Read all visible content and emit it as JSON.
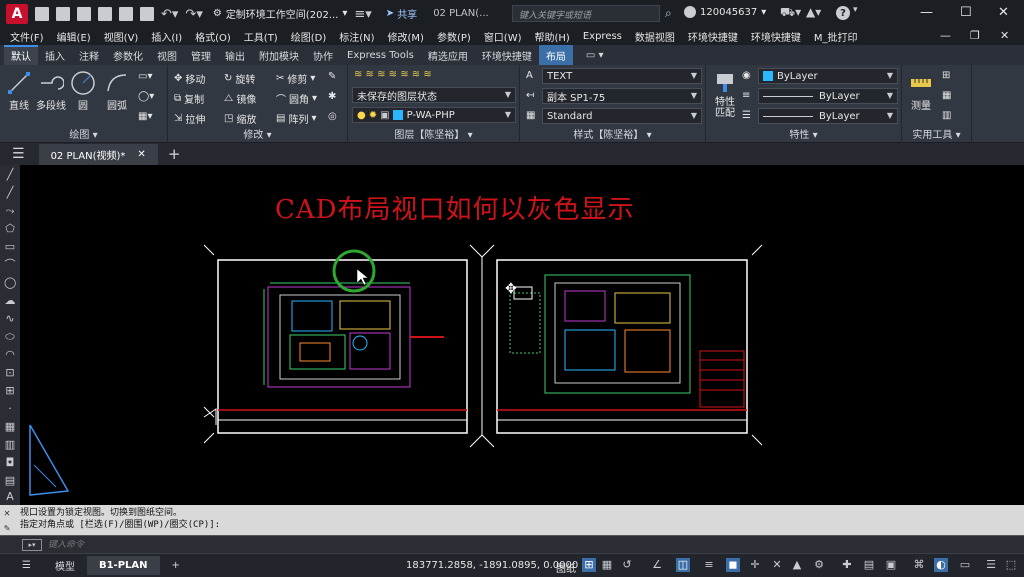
{
  "titlebar": {
    "app_logo": "A",
    "workspace_label": "定制环境工作空间(202...",
    "share_label": "共享",
    "doc_title": "02 PLAN(...",
    "search_placeholder": "键入关键字或短语",
    "user_id": "120045637",
    "help_label": "?"
  },
  "menubar": {
    "items": [
      "文件(F)",
      "编辑(E)",
      "视图(V)",
      "插入(I)",
      "格式(O)",
      "工具(T)",
      "绘图(D)",
      "标注(N)",
      "修改(M)",
      "参数(P)",
      "窗口(W)",
      "帮助(H)",
      "Express",
      "数据视图",
      "环境快捷键",
      "环境快捷键",
      "M_批打印"
    ]
  },
  "ribbon_tabs": {
    "items": [
      "默认",
      "插入",
      "注释",
      "参数化",
      "视图",
      "管理",
      "输出",
      "附加模块",
      "协作",
      "Express Tools",
      "精选应用",
      "环境快捷键",
      "布局"
    ]
  },
  "ribbon": {
    "draw": {
      "title": "绘图 ▾",
      "line": "直线",
      "polyline": "多段线",
      "circle": "圆",
      "arc": "圆弧"
    },
    "modify": {
      "title": "修改 ▾",
      "move": "移动",
      "rotate": "旋转",
      "trim": "修剪",
      "copy": "复制",
      "mirror": "镜像",
      "fillet": "圆角",
      "stretch": "拉伸",
      "scale": "缩放",
      "array": "阵列"
    },
    "layers": {
      "title": "图层【陈坚裕】 ▾",
      "layer_state": "未保存的图层状态",
      "current_layer": "P-WA-PHP"
    },
    "styles": {
      "title": "样式【陈坚裕】 ▾",
      "text_style": "TEXT",
      "dim_style": "副本 SP1-75",
      "table_style": "Standard"
    },
    "properties": {
      "title": "特性 ▾",
      "match_label": "特性\n匹配",
      "color": "ByLayer",
      "linetype": "ByLayer",
      "lineweight": "ByLayer"
    },
    "utilities": {
      "title": "实用工具 ▾",
      "measure": "测量"
    }
  },
  "doc_tabs": {
    "active_tab": "02 PLAN(视频)*"
  },
  "canvas": {
    "title_text": "CAD布局视口如何以灰色显示"
  },
  "command": {
    "history_line1": "视口设置为锁定视图。切换到图纸空间。",
    "history_line2": "指定对角点或 [栏选(F)/圈围(WP)/圈交(CP)]:",
    "input_placeholder": "键入命令"
  },
  "statusbar": {
    "tab_model": "模型",
    "tab_layout": "B1-PLAN",
    "coords": "183771.2858, -1891.0895, 0.0000",
    "paper_label": "图纸"
  },
  "colors": {
    "accent": "#3c8ee8",
    "title_red": "#d0121b",
    "canvas_bg": "#000000"
  }
}
